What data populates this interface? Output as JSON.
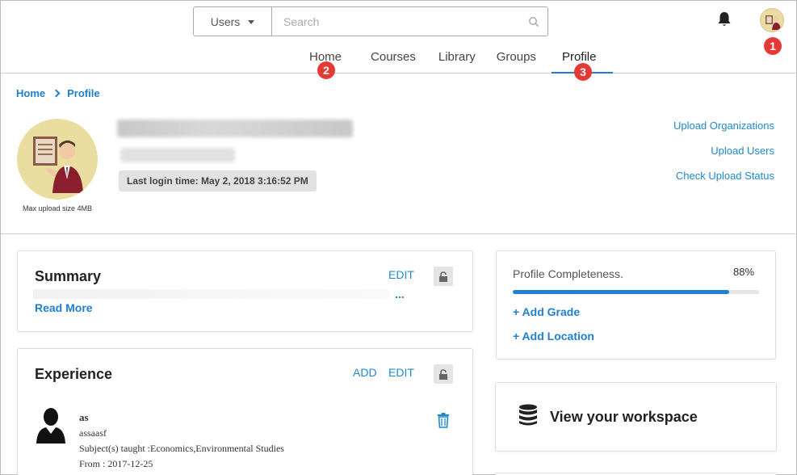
{
  "header": {
    "scope_select": "Users",
    "search_placeholder": "Search",
    "nav_tabs": [
      {
        "label": "Home"
      },
      {
        "label": "Courses"
      },
      {
        "label": "Library"
      },
      {
        "label": "Groups"
      },
      {
        "label": "Profile",
        "active": true
      }
    ],
    "markers": [
      "1",
      "2",
      "3"
    ]
  },
  "breadcrumb": [
    "Home",
    "Profile"
  ],
  "profile": {
    "upload_note": "Max upload size 4MB",
    "last_login": "Last login time: May 2, 2018 3:16:52 PM",
    "side_links": [
      "Upload Organizations",
      "Upload Users",
      "Check Upload Status"
    ]
  },
  "summary": {
    "title": "Summary",
    "edit_label": "EDIT",
    "ellipsis": "...",
    "read_more": "Read More"
  },
  "experience": {
    "title": "Experience",
    "add_label": "ADD",
    "edit_label": "EDIT",
    "entry": {
      "title": "as",
      "org": "assaasf",
      "subjects": "Subject(s) taught :Economics,Environmental Studies",
      "from": "From : 2017-12-25"
    }
  },
  "completeness": {
    "label": "Profile Completeness.",
    "percent_text": "88%",
    "percent": 0.88,
    "add_grade": "+ Add Grade",
    "add_location": "+ Add Location"
  },
  "workspace": {
    "label": "View your workspace"
  },
  "colors": {
    "accent": "#1f7fd0",
    "link": "#1f8acb",
    "marker": "#e53935"
  }
}
